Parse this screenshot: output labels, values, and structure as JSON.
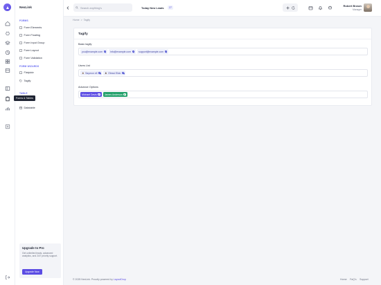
{
  "app": {
    "name": "NexLink"
  },
  "rail": {
    "tooltip": "Forms & Tables",
    "icons": [
      "home-icon",
      "bug-icon",
      "layers-icon",
      "chart-icon",
      "grid-icon",
      "table-icon",
      "layout-icon",
      "clipboard-icon",
      "stats-icon",
      "plus-icon",
      "logout-icon"
    ]
  },
  "sidebar": {
    "sections": [
      {
        "title": "FORMS",
        "items": [
          "Form Elements",
          "Form Floating",
          "Form Input Group",
          "Form Layout",
          "Form Validation"
        ]
      },
      {
        "title": "FORM WIZARDS",
        "items": [
          "Flatpickr",
          "Tagify"
        ]
      },
      {
        "title": "TABLE",
        "items": [
          "Datatable"
        ]
      }
    ],
    "promo": {
      "title": "Upgrade to Pro",
      "text": "Get unlimited leads, advanced analytics, and 24/7 priority support.",
      "button": "Upgrade Now"
    }
  },
  "topbar": {
    "search_placeholder": "Search anything's",
    "leads_label": "Today New Leads",
    "leads_count": "27",
    "user": {
      "name": "Robert Brown",
      "role": "Manager"
    }
  },
  "breadcrumb": {
    "home": "Home",
    "separator": ">",
    "current": "Tagify"
  },
  "card": {
    "title": "Tagify",
    "fields": [
      {
        "label": "Basic tagify",
        "tags": [
          "you@example.com",
          "info@example.com",
          "support@example.com"
        ]
      },
      {
        "label": "Users List",
        "tags": [
          "Saymon ell",
          "Elessi Elick"
        ]
      },
      {
        "label": "Advance Options",
        "tags": [
          "Michael Davis",
          "James Anderson"
        ]
      }
    ]
  },
  "footer": {
    "copyright": "© 2025 NexLink. Proudly powered by",
    "company": "LayoutDrop",
    "links": [
      "Home",
      "FaQ's",
      "Support"
    ]
  },
  "colors": {
    "accent": "#5b4ce3",
    "tag_bg": "#eef0fb",
    "tag_purple": "#5b4ce3",
    "tag_green": "#22a06b"
  }
}
